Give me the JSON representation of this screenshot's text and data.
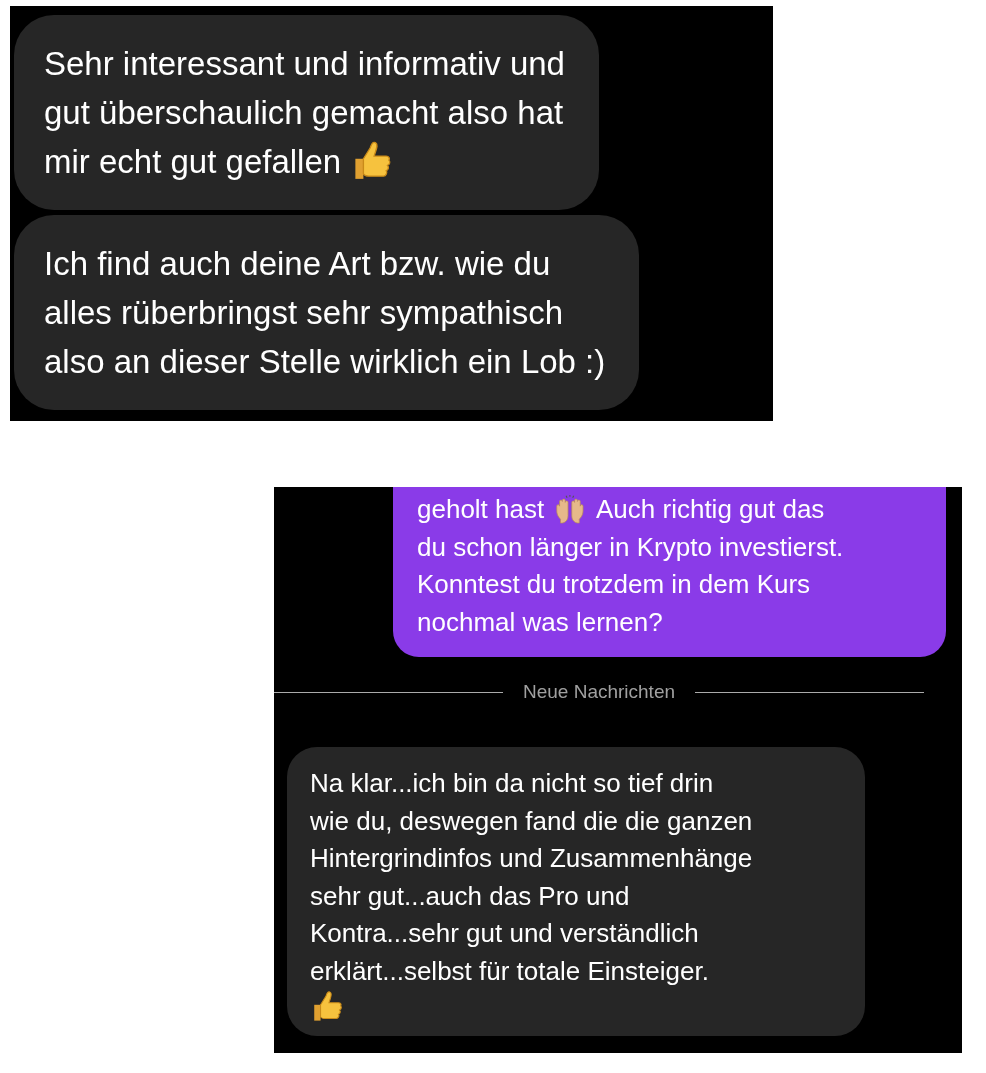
{
  "panels": [
    {
      "messages": [
        {
          "kind": "incoming",
          "lines": [
            [
              {
                "kind": "text",
                "text": "Sehr interessant und informativ und"
              }
            ],
            [
              {
                "kind": "text",
                "text": "gut überschaulich gemacht also hat"
              }
            ],
            [
              {
                "kind": "text",
                "text": "mir echt gut gefallen"
              },
              {
                "kind": "thumbs_up"
              }
            ]
          ]
        },
        {
          "kind": "incoming",
          "lines": [
            [
              {
                "kind": "text",
                "text": "Ich find auch deine Art bzw. wie du"
              }
            ],
            [
              {
                "kind": "text",
                "text": "alles rüberbringst sehr sympathisch"
              }
            ],
            [
              {
                "kind": "text",
                "text": "also an dieser Stelle wirklich ein Lob :)"
              }
            ]
          ]
        }
      ]
    },
    {
      "messages": [
        {
          "kind": "outgoing",
          "lines": [
            [
              {
                "kind": "text",
                "text": "geholt hast"
              },
              {
                "kind": "raised_hands"
              },
              {
                "kind": "text",
                "text": "Auch richtig gut das"
              }
            ],
            [
              {
                "kind": "text",
                "text": "du schon länger in Krypto investierst."
              }
            ],
            [
              {
                "kind": "text",
                "text": "Konntest du trotzdem in dem Kurs"
              }
            ],
            [
              {
                "kind": "text",
                "text": "nochmal was lernen?"
              }
            ]
          ]
        },
        {
          "kind": "divider",
          "label": "Neue Nachrichten"
        },
        {
          "kind": "incoming",
          "lines": [
            [
              {
                "kind": "text",
                "text": "Na klar...ich bin da nicht so tief drin"
              }
            ],
            [
              {
                "kind": "text",
                "text": "wie du, deswegen fand die die ganzen"
              }
            ],
            [
              {
                "kind": "text",
                "text": "Hintergrindinfos und Zusammenhänge"
              }
            ],
            [
              {
                "kind": "text",
                "text": "sehr gut...auch das Pro und"
              }
            ],
            [
              {
                "kind": "text",
                "text": "Kontra...sehr gut und verständlich"
              }
            ],
            [
              {
                "kind": "text",
                "text": "erklärt...selbst für totale Einsteiger."
              }
            ],
            [
              {
                "kind": "thumbs_up"
              }
            ]
          ]
        }
      ]
    }
  ]
}
